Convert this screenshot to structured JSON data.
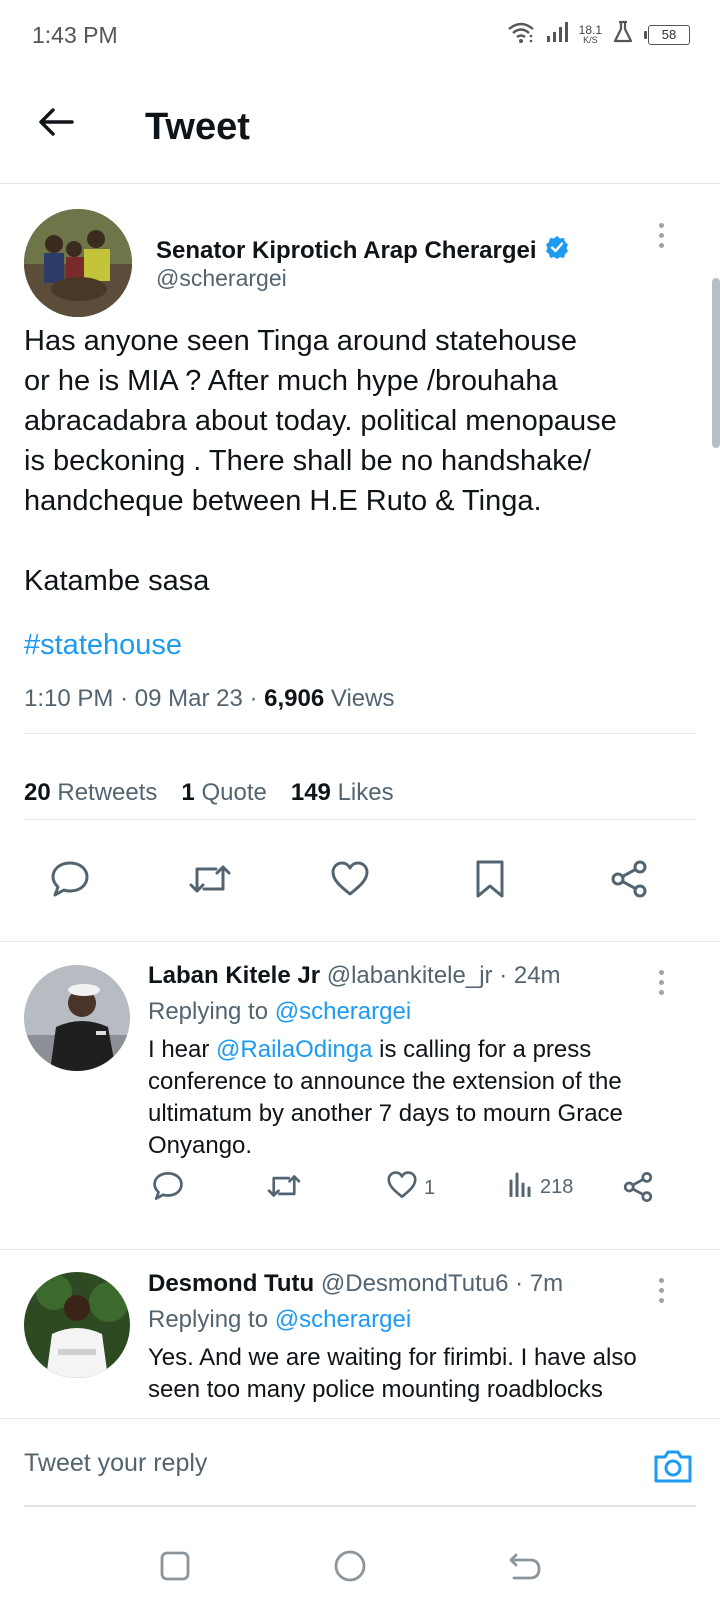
{
  "status_bar": {
    "time": "1:43 PM",
    "net_speed_value": "18.1",
    "net_speed_unit": "K/S",
    "battery": "58",
    "icons": [
      "wifi-icon",
      "signal-icon",
      "flask-icon",
      "battery-icon"
    ]
  },
  "header": {
    "title": "Tweet",
    "back_icon": "arrow-left-icon"
  },
  "tweet": {
    "author_name": "Senator Kiprotich Arap Cherargei",
    "author_handle": "@scherargei",
    "verified": true,
    "body": "Has anyone seen Tinga around statehouse\nor he is MIA ? After much hype /brouhaha\nabracadabra about today. political menopause\nis beckoning . There shall be no handshake/\nhandcheque between H.E Ruto & Tinga.\n\nKatambe sasa",
    "hashtag": "#statehouse",
    "time": "1:10 PM",
    "date": "09 Mar 23",
    "separator": "·",
    "views_count": "6,906",
    "views_label": "Views",
    "retweets_count": "20",
    "retweets_label": "Retweets",
    "quotes_count": "1",
    "quotes_label": "Quote",
    "likes_count": "149",
    "likes_label": "Likes",
    "actions": [
      "reply-icon",
      "retweet-icon",
      "like-icon",
      "bookmark-icon",
      "share-icon"
    ]
  },
  "replies": [
    {
      "name": "Laban Kitele Jr",
      "handle": "@labankitele_jr",
      "time": "· 24m",
      "replying_label": "Replying to",
      "replying_to": "@scherargei",
      "text_mention": "@RailaOdinga",
      "text_prefix": "I hear ",
      "text_suffix": " is calling for a press conference to announce the extension of the ultimatum by another 7 days to mourn Grace Onyango.",
      "likes": "1",
      "views": "218"
    },
    {
      "name": "Desmond Tutu",
      "handle": "@DesmondTutu6",
      "time": "· 7m",
      "replying_label": "Replying to",
      "replying_to": "@scherargei",
      "text": "Yes. And we are waiting for firimbi. I have also seen too many police mounting roadblocks"
    }
  ],
  "compose": {
    "placeholder": "Tweet your reply",
    "camera_icon": "camera-icon"
  },
  "navbar": {
    "icons": [
      "recents-icon",
      "home-icon",
      "back-icon"
    ]
  },
  "colors": {
    "accent": "#1d9bf0",
    "text_primary": "#0f1419",
    "text_secondary": "#536471",
    "divider": "#e6e9ec"
  }
}
